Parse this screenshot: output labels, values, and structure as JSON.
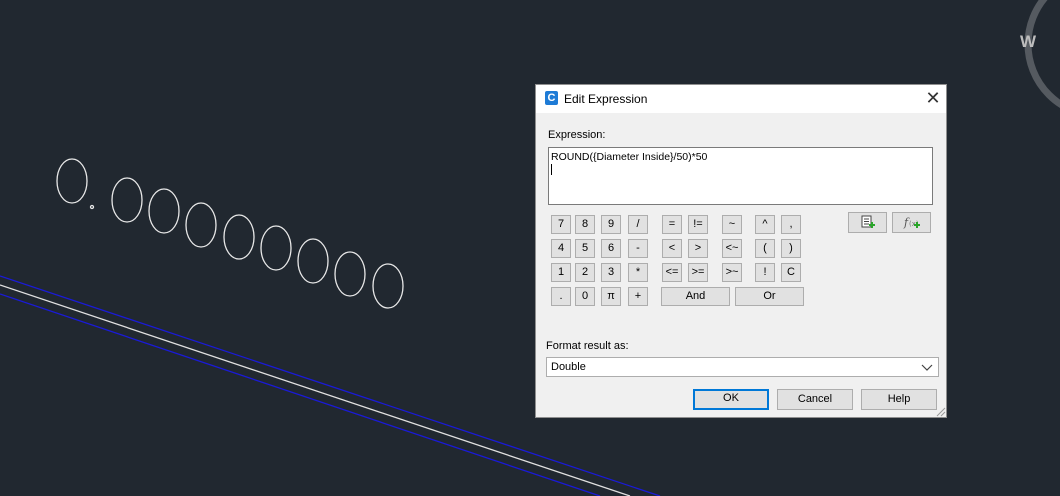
{
  "canvas": {
    "compass_letter": "W",
    "colors": {
      "background": "#212830",
      "outline": "#e8e8e8",
      "polyline_blue": "#1a1ad8",
      "polyline_white": "#e0e0e0"
    }
  },
  "dialog": {
    "title": "Edit Expression",
    "app_icon_letter": "C",
    "close_glyph": "✕",
    "expression_label": "Expression:",
    "expression_value": "ROUND({Diameter Inside}/50)*50",
    "keypad": {
      "row1": [
        "7",
        "8",
        "9",
        "/",
        "=",
        "!=",
        "~",
        "^",
        ","
      ],
      "row2": [
        "4",
        "5",
        "6",
        "-",
        "<",
        ">",
        "<~",
        "(",
        ")"
      ],
      "row3": [
        "1",
        "2",
        "3",
        "*",
        "<=",
        ">=",
        ">~",
        "!",
        "C"
      ],
      "row4": [
        ".",
        "0",
        "π",
        "+",
        "And",
        "Or"
      ]
    },
    "tool_icons": [
      "insert-property-icon",
      "insert-function-icon"
    ],
    "format_label": "Format result as:",
    "format_value": "Double",
    "buttons": {
      "ok": "OK",
      "cancel": "Cancel",
      "help": "Help"
    },
    "colors": {
      "accent": "#0078d7",
      "icon_blue": "#1e7bd6",
      "icon_green": "#2aa52a"
    }
  }
}
